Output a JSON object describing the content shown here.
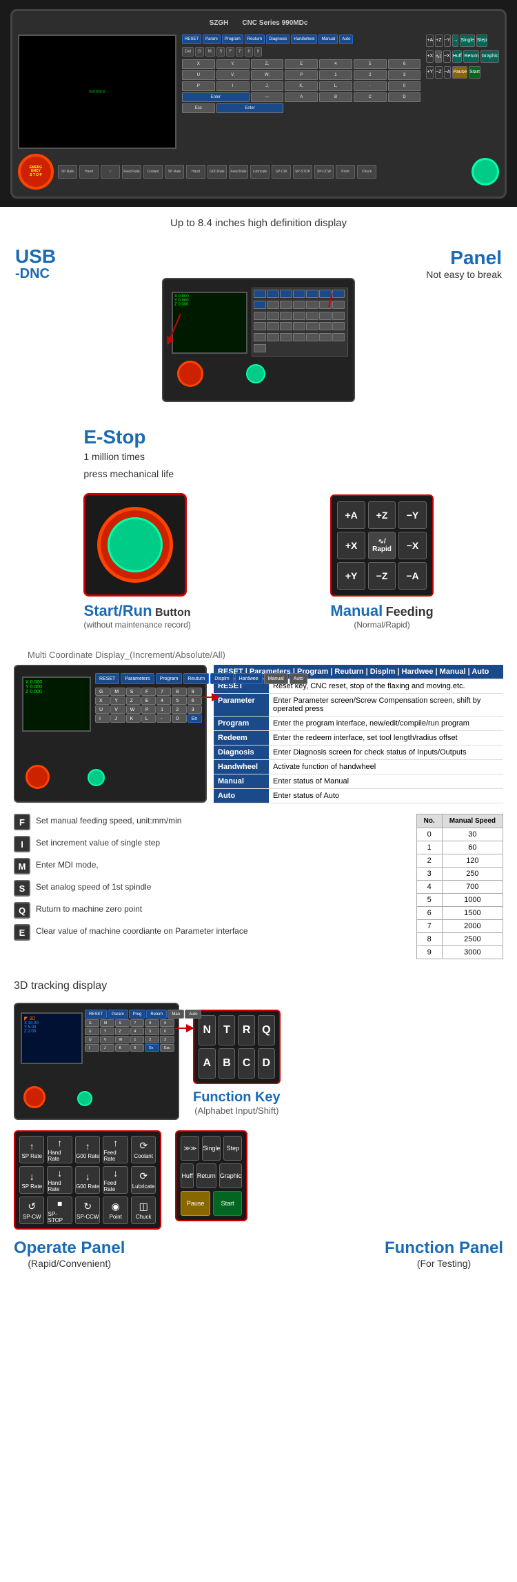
{
  "header": {
    "brand": "SZGH",
    "model": "CNC Series 990MDc"
  },
  "top_annotation": "Up to 8.4 inches high definition display",
  "features": {
    "usb": {
      "label": "USB",
      "sub": "-DNC"
    },
    "panel": {
      "label": "Panel",
      "desc": "Not easy to break"
    },
    "estop": {
      "label": "E-Stop",
      "desc1": "1 million times",
      "desc2": "press mechanical life"
    },
    "startrun": {
      "label1": "Start/Run",
      "label2": "Button",
      "desc": "(without maintenance record)"
    },
    "manual": {
      "label": "Manual",
      "sub": "Feeding",
      "desc": "(Normal/Rapid)"
    }
  },
  "manual_feed_buttons": [
    [
      "+A",
      "+Z",
      "-Y"
    ],
    [
      "+X",
      "Rapid",
      "-X"
    ],
    [
      "+Y",
      "-Z",
      "-A"
    ]
  ],
  "coord_display": {
    "title": "Multi Coordinate Display_",
    "subtitle": "(Increment/Absolute/All)"
  },
  "annotation_table": {
    "header": [
      "RESET",
      "Parameter",
      "Program",
      "Redeem",
      "Diagnosis",
      "Handwheel",
      "Manual",
      "Auto"
    ],
    "rows": [
      {
        "key": "RESET",
        "desc": "Reset key, CNC reset, stop of the flaxing and moving.etc."
      },
      {
        "key": "Parameter",
        "desc": "Enter Parameter screen/Screw Compensation screen, shift by operated press"
      },
      {
        "key": "Program",
        "desc": "Enter the program interface, new/edit/compile/run program"
      },
      {
        "key": "Redeem",
        "desc": "Enter the redeem interface, set tool length/radius offset"
      },
      {
        "key": "Diagnosis",
        "desc": "Enter Diagnosis screen for check status of Inputs/Outputs"
      },
      {
        "key": "Handwheel",
        "desc": "Activate function of handwheel"
      },
      {
        "key": "Manual",
        "desc": "Enter status of Manual"
      },
      {
        "key": "Auto",
        "desc": "Enter status of Auto"
      }
    ]
  },
  "keys": [
    {
      "key": "F",
      "desc": "Set manual feeding speed, unit:mm/min"
    },
    {
      "key": "I",
      "desc": "Set increment value of single step"
    },
    {
      "key": "M",
      "desc": "Enter MDI mode,"
    },
    {
      "key": "S",
      "desc": "Set analog speed of 1st spindle"
    },
    {
      "key": "Q",
      "desc": "Ruturn to machine zero point"
    },
    {
      "key": "E",
      "desc": "Clear value of machine coordiante on Parameter interface"
    }
  ],
  "speed_table": {
    "headers": [
      "No.",
      "Manual Speed"
    ],
    "rows": [
      [
        "0",
        "30"
      ],
      [
        "1",
        "60"
      ],
      [
        "2",
        "120"
      ],
      [
        "3",
        "250"
      ],
      [
        "4",
        "700"
      ],
      [
        "5",
        "1000"
      ],
      [
        "6",
        "1500"
      ],
      [
        "7",
        "2000"
      ],
      [
        "8",
        "2500"
      ],
      [
        "9",
        "3000"
      ]
    ]
  },
  "tracking": {
    "title": "3D tracking display"
  },
  "func_keys": {
    "label": "Function Key",
    "desc": "(Alphabet Input/Shift)",
    "keys": [
      "N",
      "T",
      "R",
      "Q",
      "A",
      "B",
      "C",
      "D"
    ]
  },
  "operate_panel": {
    "label": "Operate Panel",
    "desc": "(Rapid/Convenient)",
    "row1": [
      {
        "icon": "↑",
        "label": "SP Rate"
      },
      {
        "icon": "↑",
        "label": "Hand Rate"
      },
      {
        "icon": "↑",
        "label": "G00 Rate"
      },
      {
        "icon": "↑",
        "label": "Feed Rate"
      },
      {
        "icon": "⟳",
        "label": "Coolant"
      }
    ],
    "row2": [
      {
        "icon": "↓",
        "label": "SP Rate"
      },
      {
        "icon": "↓",
        "label": "Hand Rate"
      },
      {
        "icon": "↓",
        "label": "G00 Rate"
      },
      {
        "icon": "↓",
        "label": "Feed Rate"
      },
      {
        "icon": "⟳",
        "label": "Lubricate"
      }
    ],
    "row3": [
      {
        "icon": "↺",
        "label": "SP-CW"
      },
      {
        "icon": "⏹",
        "label": "SP-STOP"
      },
      {
        "icon": "↻",
        "label": "SP-CCW"
      },
      {
        "icon": "◉",
        "label": "Point"
      },
      {
        "icon": "◫",
        "label": "Chuck"
      }
    ]
  },
  "function_panel": {
    "label": "Function Panel",
    "desc": "(For Testing)",
    "row1": [
      {
        "label": "≫≫",
        "style": "normal"
      },
      {
        "label": "Single",
        "style": "normal"
      },
      {
        "label": "Step",
        "style": "normal"
      }
    ],
    "row2": [
      {
        "label": "Huff",
        "style": "normal"
      },
      {
        "label": "Return",
        "style": "normal"
      },
      {
        "label": "Graphic",
        "style": "normal"
      }
    ],
    "row3": [
      {
        "label": "Pause",
        "style": "yellow"
      },
      {
        "label": "Start",
        "style": "green"
      }
    ]
  },
  "screen_coords": {
    "x": "X  0.000",
    "y": "Y  0.000",
    "z": "Z  0.000"
  }
}
